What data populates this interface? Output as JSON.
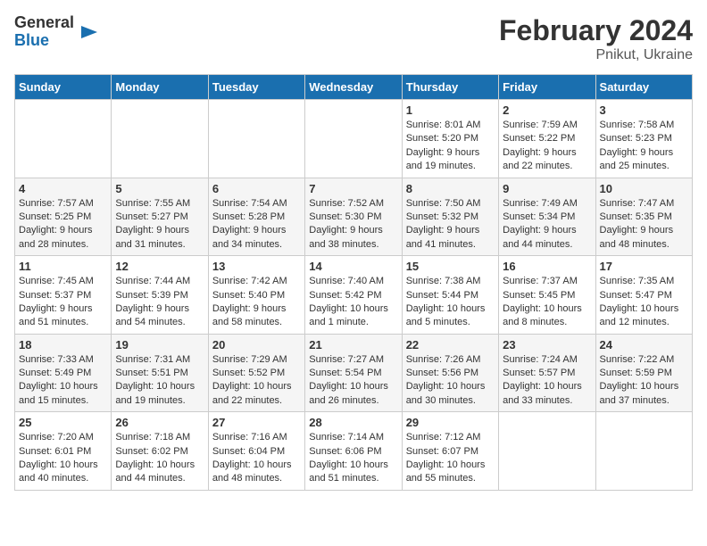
{
  "header": {
    "logo_line1": "General",
    "logo_line2": "Blue",
    "title": "February 2024",
    "subtitle": "Pnikut, Ukraine"
  },
  "weekdays": [
    "Sunday",
    "Monday",
    "Tuesday",
    "Wednesday",
    "Thursday",
    "Friday",
    "Saturday"
  ],
  "weeks": [
    [
      {
        "day": "",
        "info": ""
      },
      {
        "day": "",
        "info": ""
      },
      {
        "day": "",
        "info": ""
      },
      {
        "day": "",
        "info": ""
      },
      {
        "day": "1",
        "info": "Sunrise: 8:01 AM\nSunset: 5:20 PM\nDaylight: 9 hours\nand 19 minutes."
      },
      {
        "day": "2",
        "info": "Sunrise: 7:59 AM\nSunset: 5:22 PM\nDaylight: 9 hours\nand 22 minutes."
      },
      {
        "day": "3",
        "info": "Sunrise: 7:58 AM\nSunset: 5:23 PM\nDaylight: 9 hours\nand 25 minutes."
      }
    ],
    [
      {
        "day": "4",
        "info": "Sunrise: 7:57 AM\nSunset: 5:25 PM\nDaylight: 9 hours\nand 28 minutes."
      },
      {
        "day": "5",
        "info": "Sunrise: 7:55 AM\nSunset: 5:27 PM\nDaylight: 9 hours\nand 31 minutes."
      },
      {
        "day": "6",
        "info": "Sunrise: 7:54 AM\nSunset: 5:28 PM\nDaylight: 9 hours\nand 34 minutes."
      },
      {
        "day": "7",
        "info": "Sunrise: 7:52 AM\nSunset: 5:30 PM\nDaylight: 9 hours\nand 38 minutes."
      },
      {
        "day": "8",
        "info": "Sunrise: 7:50 AM\nSunset: 5:32 PM\nDaylight: 9 hours\nand 41 minutes."
      },
      {
        "day": "9",
        "info": "Sunrise: 7:49 AM\nSunset: 5:34 PM\nDaylight: 9 hours\nand 44 minutes."
      },
      {
        "day": "10",
        "info": "Sunrise: 7:47 AM\nSunset: 5:35 PM\nDaylight: 9 hours\nand 48 minutes."
      }
    ],
    [
      {
        "day": "11",
        "info": "Sunrise: 7:45 AM\nSunset: 5:37 PM\nDaylight: 9 hours\nand 51 minutes."
      },
      {
        "day": "12",
        "info": "Sunrise: 7:44 AM\nSunset: 5:39 PM\nDaylight: 9 hours\nand 54 minutes."
      },
      {
        "day": "13",
        "info": "Sunrise: 7:42 AM\nSunset: 5:40 PM\nDaylight: 9 hours\nand 58 minutes."
      },
      {
        "day": "14",
        "info": "Sunrise: 7:40 AM\nSunset: 5:42 PM\nDaylight: 10 hours\nand 1 minute."
      },
      {
        "day": "15",
        "info": "Sunrise: 7:38 AM\nSunset: 5:44 PM\nDaylight: 10 hours\nand 5 minutes."
      },
      {
        "day": "16",
        "info": "Sunrise: 7:37 AM\nSunset: 5:45 PM\nDaylight: 10 hours\nand 8 minutes."
      },
      {
        "day": "17",
        "info": "Sunrise: 7:35 AM\nSunset: 5:47 PM\nDaylight: 10 hours\nand 12 minutes."
      }
    ],
    [
      {
        "day": "18",
        "info": "Sunrise: 7:33 AM\nSunset: 5:49 PM\nDaylight: 10 hours\nand 15 minutes."
      },
      {
        "day": "19",
        "info": "Sunrise: 7:31 AM\nSunset: 5:51 PM\nDaylight: 10 hours\nand 19 minutes."
      },
      {
        "day": "20",
        "info": "Sunrise: 7:29 AM\nSunset: 5:52 PM\nDaylight: 10 hours\nand 22 minutes."
      },
      {
        "day": "21",
        "info": "Sunrise: 7:27 AM\nSunset: 5:54 PM\nDaylight: 10 hours\nand 26 minutes."
      },
      {
        "day": "22",
        "info": "Sunrise: 7:26 AM\nSunset: 5:56 PM\nDaylight: 10 hours\nand 30 minutes."
      },
      {
        "day": "23",
        "info": "Sunrise: 7:24 AM\nSunset: 5:57 PM\nDaylight: 10 hours\nand 33 minutes."
      },
      {
        "day": "24",
        "info": "Sunrise: 7:22 AM\nSunset: 5:59 PM\nDaylight: 10 hours\nand 37 minutes."
      }
    ],
    [
      {
        "day": "25",
        "info": "Sunrise: 7:20 AM\nSunset: 6:01 PM\nDaylight: 10 hours\nand 40 minutes."
      },
      {
        "day": "26",
        "info": "Sunrise: 7:18 AM\nSunset: 6:02 PM\nDaylight: 10 hours\nand 44 minutes."
      },
      {
        "day": "27",
        "info": "Sunrise: 7:16 AM\nSunset: 6:04 PM\nDaylight: 10 hours\nand 48 minutes."
      },
      {
        "day": "28",
        "info": "Sunrise: 7:14 AM\nSunset: 6:06 PM\nDaylight: 10 hours\nand 51 minutes."
      },
      {
        "day": "29",
        "info": "Sunrise: 7:12 AM\nSunset: 6:07 PM\nDaylight: 10 hours\nand 55 minutes."
      },
      {
        "day": "",
        "info": ""
      },
      {
        "day": "",
        "info": ""
      }
    ]
  ]
}
